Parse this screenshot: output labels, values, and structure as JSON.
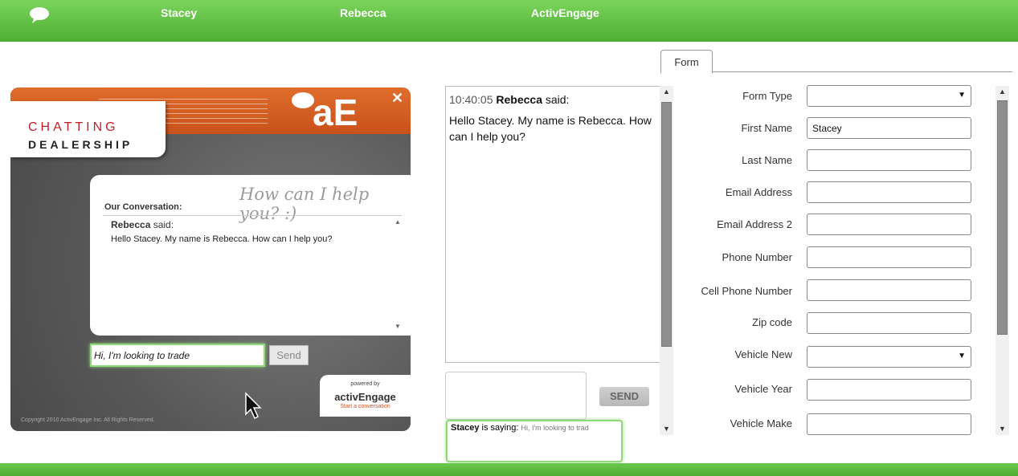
{
  "topbar": {
    "tabs": [
      "Stacey",
      "Rebecca",
      "ActivEngage"
    ]
  },
  "widget": {
    "logo_line1": "CHATTING",
    "logo_line2": "DEALERSHIP",
    "ae_logo": "aE",
    "close_label": "✕",
    "script_text": "How can I help you? :)",
    "conversation_title": "Our Conversation:",
    "message_author": "Rebecca",
    "message_said": " said:",
    "message_text": "Hello Stacey. My name is Rebecca. How can I help you?",
    "input_value": "Hi, I'm looking to trade",
    "send_label": "Send",
    "powered_by": "powered by",
    "powered_brand": "activEngage",
    "powered_tagline": "Start a conversation",
    "copyright": "Copyright 2010 ActivEngage Inc. All Rights Reserved."
  },
  "agent_chat": {
    "time": "10:40:05",
    "author": "Rebecca",
    "said": " said:",
    "message": "Hello Stacey. My name is Rebecca. How can I help you?",
    "send_label": "SEND",
    "typing_name": "Stacey",
    "typing_suffix": " is saying: ",
    "typing_preview": "Hi, I'm looking to trad"
  },
  "form": {
    "tab_label": "Form",
    "fields": [
      {
        "label": "Form Type",
        "value": "",
        "type": "select"
      },
      {
        "label": "First Name",
        "value": "Stacey",
        "type": "text"
      },
      {
        "label": "Last Name",
        "value": "",
        "type": "text"
      },
      {
        "label": "Email Address",
        "value": "",
        "type": "text"
      },
      {
        "label": "Email Address 2",
        "value": "",
        "type": "text"
      },
      {
        "label": "Phone Number",
        "value": "",
        "type": "text"
      },
      {
        "label": "Cell Phone Number",
        "value": "",
        "type": "text"
      },
      {
        "label": "Zip code",
        "value": "",
        "type": "text"
      },
      {
        "label": "Vehicle New",
        "value": "",
        "type": "select"
      },
      {
        "label": "Vehicle Year",
        "value": "",
        "type": "text"
      },
      {
        "label": "Vehicle Make",
        "value": "",
        "type": "text"
      }
    ]
  },
  "colors": {
    "topbar_green": "#5cbf3e",
    "widget_orange": "#d45e22",
    "focus_green": "#8fd97a"
  },
  "icons": [
    "chat-bubble-icon",
    "close-icon",
    "scroll-up-icon",
    "scroll-down-icon",
    "dropdown-caret-icon",
    "mouse-cursor-icon"
  ]
}
